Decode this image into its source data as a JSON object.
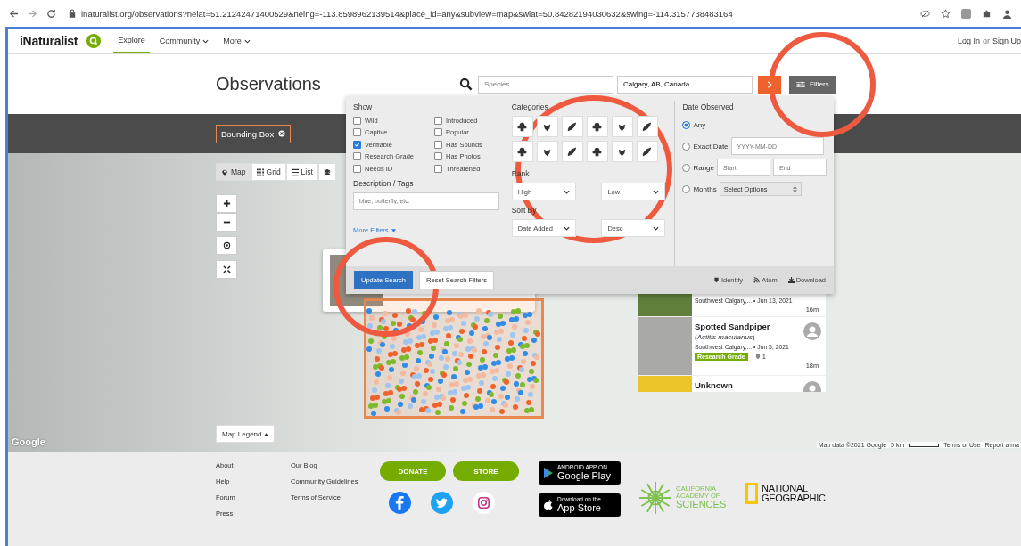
{
  "browser": {
    "url": "inaturalist.org/observations?nelat=51.21242471400529&nelng=-113.8598962139514&place_id=any&subview=map&swlat=50.84282194030632&swlng=-114.3157738483164"
  },
  "header": {
    "logo": "iNaturalist",
    "nav": [
      {
        "label": "Explore",
        "selected": true,
        "dropdown": false
      },
      {
        "label": "Community",
        "selected": false,
        "dropdown": true
      },
      {
        "label": "More",
        "selected": false,
        "dropdown": true
      }
    ],
    "login": "Log In",
    "or": "or",
    "signup": "Sign Up"
  },
  "title": "Observations",
  "search": {
    "species_placeholder": "Species",
    "location_value": "Calgary, AB, Canada",
    "filters_label": "Filters"
  },
  "chips": [
    {
      "label": "Bounding Box"
    }
  ],
  "view_toggle": [
    {
      "label": "Map",
      "kind": "map",
      "selected": true
    },
    {
      "label": "Grid",
      "kind": "grid",
      "selected": false
    },
    {
      "label": "List",
      "kind": "list",
      "selected": false
    }
  ],
  "map": {
    "legend": "Map Legend",
    "google": "Google",
    "attribution": "Map data ©2021 Google",
    "scale": "5 km",
    "terms": "Terms of Use",
    "report": "Report a ma"
  },
  "observations": [
    {
      "place": "Southwest Calgary,... • Jun 13, 2021",
      "age": "16m"
    },
    {
      "name": "Spotted Sandpiper",
      "scientific": "(*Actitis macularius*)",
      "place": "Southwest Calgary,... • Jun 5, 2021",
      "quality": "Research Grade",
      "ids": "1",
      "age": "18m"
    },
    {
      "name": "Unknown"
    }
  ],
  "filters": {
    "show_title": "Show",
    "show": [
      {
        "label": "Wild",
        "checked": false
      },
      {
        "label": "Introduced",
        "checked": false
      },
      {
        "label": "Captive",
        "checked": false
      },
      {
        "label": "Popular",
        "checked": false
      },
      {
        "label": "Verifiable",
        "checked": true
      },
      {
        "label": "Has Sounds",
        "checked": false
      },
      {
        "label": "Research Grade",
        "checked": false
      },
      {
        "label": "Has Photos",
        "checked": false
      },
      {
        "label": "Needs ID",
        "checked": false
      },
      {
        "label": "Threatened",
        "checked": false
      }
    ],
    "tags_title": "Description / Tags",
    "tags_placeholder": "blue, butterfly, etc.",
    "more": "More Filters",
    "categories_title": "Categories",
    "rank_title": "Rank",
    "rank": [
      "High",
      "Low"
    ],
    "sort_title": "Sort By",
    "sort": [
      "Date Added",
      "Desc"
    ],
    "date_title": "Date Observed",
    "date_options": [
      {
        "label": "Any",
        "selected": true,
        "kind": "plain"
      },
      {
        "label": "Exact Date",
        "selected": false,
        "kind": "date",
        "placeholders": [
          "YYYY-MM-DD"
        ]
      },
      {
        "label": "Range",
        "selected": false,
        "kind": "range",
        "placeholders": [
          "Start",
          "End"
        ]
      },
      {
        "label": "Months",
        "selected": false,
        "kind": "select",
        "value": "Select Options"
      }
    ],
    "update": "Update Search",
    "reset": "Reset Search Filters",
    "links": [
      {
        "kind": "identify",
        "label": "Identify"
      },
      {
        "kind": "atom",
        "label": "Atom"
      },
      {
        "kind": "download",
        "label": "Download"
      }
    ]
  },
  "footer": {
    "col1": [
      "About",
      "Help",
      "Forum",
      "Press"
    ],
    "col2": [
      "Our Blog",
      "Community Guidelines",
      "Terms of Service"
    ],
    "buttons": [
      "DONATE",
      "STORE"
    ],
    "badges": [
      {
        "kind": "android",
        "small": "ANDROID APP ON",
        "big": "Google Play"
      },
      {
        "kind": "apple",
        "small": "Download on the",
        "big": "App Store"
      }
    ],
    "academy": [
      "CALIFORNIA",
      "ACADEMY OF",
      "SCIENCES"
    ],
    "natgeo": [
      "NATIONAL",
      "GEOGRAPHIC"
    ]
  }
}
